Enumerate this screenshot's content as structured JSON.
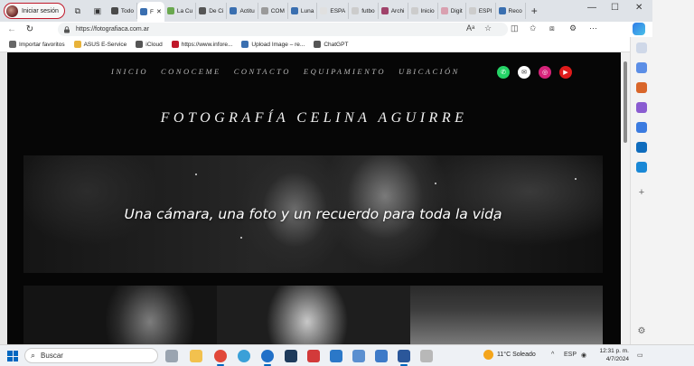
{
  "browser": {
    "profile_label": "Iniciar sesión",
    "tabs": [
      {
        "label": "Todo",
        "color": "#4a4a4a"
      },
      {
        "label": "F",
        "color": "#3a6fb0",
        "active": true
      },
      {
        "label": "La Cu",
        "color": "#6aa84f"
      },
      {
        "label": "De Ci",
        "color": "#555555"
      },
      {
        "label": "Actitu",
        "color": "#3a6fb0"
      },
      {
        "label": "COM",
        "color": "#9a9a9a"
      },
      {
        "label": "Luna",
        "color": "#3a6fb0"
      },
      {
        "label": "ESPA",
        "color": "#e0e0e0"
      },
      {
        "label": "futbo",
        "color": "#cccccc"
      },
      {
        "label": "Archi",
        "color": "#a0426a"
      },
      {
        "label": "Inicio",
        "color": "#cccccc"
      },
      {
        "label": "Digit",
        "color": "#d9a0b0"
      },
      {
        "label": "ESPI",
        "color": "#cccccc"
      },
      {
        "label": "Reco",
        "color": "#3a6fb0"
      }
    ],
    "url": "https://fotografiaca.com.ar",
    "favorites": [
      {
        "label": "Importar favoritos",
        "color": "#666666"
      },
      {
        "label": "ASUS E-Service",
        "color": "#e8b33a"
      },
      {
        "label": "iCloud",
        "color": "#555555"
      },
      {
        "label": "https://www.infore...",
        "color": "#c0182a"
      },
      {
        "label": "Upload Image – re...",
        "color": "#3a6fb0"
      },
      {
        "label": "ChatGPT",
        "color": "#555555"
      }
    ]
  },
  "site": {
    "nav": [
      "INICIO",
      "CONOCEME",
      "CONTACTO",
      "EQUIPAMIENTO",
      "UBICACIÓN"
    ],
    "social_colors": [
      "#25d366",
      "#ffffff",
      "#d6247a",
      "#e01b1b"
    ],
    "title": "FOTOGRAFÍA CELINA AGUIRRE",
    "hero_text": "Una cámara, una foto y un recuerdo para toda la vida"
  },
  "taskbar": {
    "search_placeholder": "Buscar",
    "weather": "11°C  Soleado",
    "lang": "ESP",
    "time": "12:31 p. m.",
    "date": "4/7/2024"
  }
}
